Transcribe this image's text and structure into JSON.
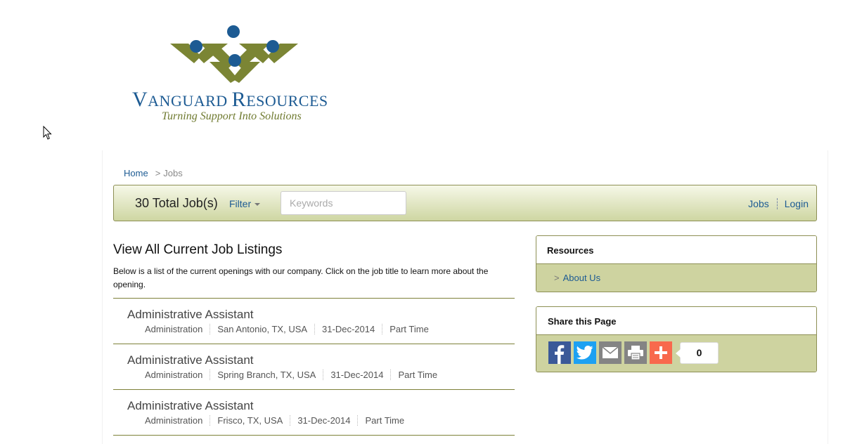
{
  "logo": {
    "name_first_cap": "V",
    "name_first_rest": "ANGUARD",
    "name_second_cap": "R",
    "name_second_rest": "ESOURCES",
    "tagline": "Turning Support Into Solutions",
    "colors": {
      "green": "#7b8534",
      "blue": "#1d5b93"
    }
  },
  "breadcrumb": {
    "home": "Home",
    "separator": ">",
    "current": "Jobs"
  },
  "toolbar": {
    "total": "30 Total Job(s)",
    "filter_label": "Filter",
    "keywords_placeholder": "Keywords",
    "keywords_value": "",
    "nav_jobs": "Jobs",
    "nav_login": "Login"
  },
  "main": {
    "heading": "View All Current Job Listings",
    "intro": "Below is a list of the current openings with our company. Click on the job title to learn more about the opening.",
    "jobs": [
      {
        "title": "Administrative Assistant",
        "category": "Administration",
        "location": "San Antonio, TX, USA",
        "date": "31-Dec-2014",
        "type": "Part Time"
      },
      {
        "title": "Administrative Assistant",
        "category": "Administration",
        "location": "Spring Branch, TX, USA",
        "date": "31-Dec-2014",
        "type": "Part Time"
      },
      {
        "title": "Administrative Assistant",
        "category": "Administration",
        "location": "Frisco, TX, USA",
        "date": "31-Dec-2014",
        "type": "Part Time"
      }
    ]
  },
  "sidebar": {
    "resources_title": "Resources",
    "resources_link_prefix": ">",
    "resources_link": "About Us",
    "share_title": "Share this Page",
    "share_count": "0",
    "share_buttons": [
      {
        "icon": "facebook-icon",
        "color": "#3b5998"
      },
      {
        "icon": "twitter-icon",
        "color": "#1da1f2"
      },
      {
        "icon": "email-icon",
        "color": "#848484"
      },
      {
        "icon": "print-icon",
        "color": "#848484"
      },
      {
        "icon": "addthis-plus-icon",
        "color": "#f8694d"
      }
    ]
  },
  "colors": {
    "link": "#1d5b93",
    "olive_border": "#8d8f54",
    "panel_bg": "#ced3a0"
  }
}
